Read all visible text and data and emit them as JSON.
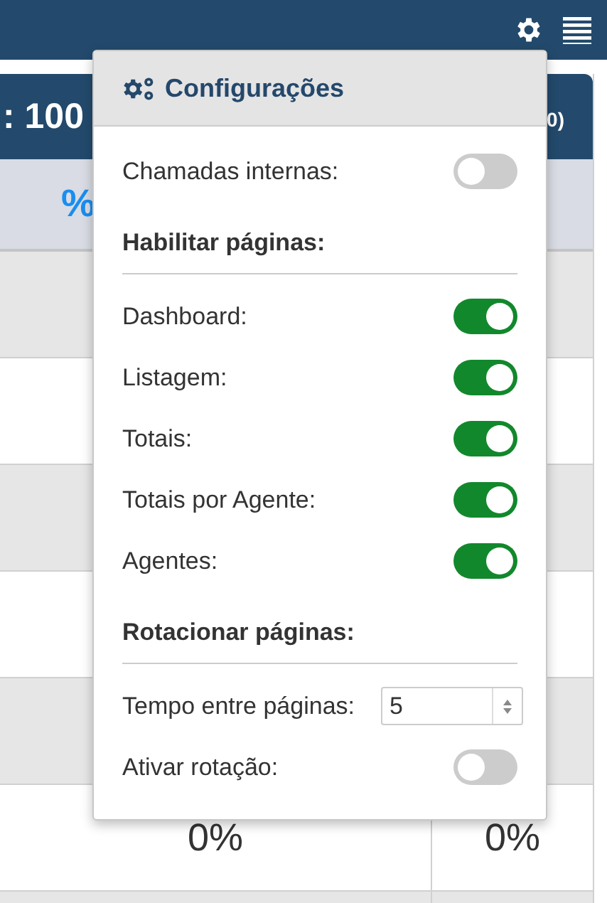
{
  "card": {
    "title": ": 100",
    "count": "0)",
    "column_header": "%",
    "bottom_row": [
      "0%",
      "0%"
    ]
  },
  "settings": {
    "title": "Configurações",
    "items": [
      {
        "kind": "toggle",
        "label": "Chamadas internas:",
        "on": false
      },
      {
        "kind": "heading",
        "label": "Habilitar páginas:"
      },
      {
        "kind": "toggle",
        "label": "Dashboard:",
        "on": true
      },
      {
        "kind": "toggle",
        "label": "Listagem:",
        "on": true
      },
      {
        "kind": "toggle",
        "label": "Totais:",
        "on": true
      },
      {
        "kind": "toggle",
        "label": "Totais por Agente:",
        "on": true
      },
      {
        "kind": "toggle",
        "label": "Agentes:",
        "on": true
      },
      {
        "kind": "heading",
        "label": "Rotacionar páginas:"
      },
      {
        "kind": "number",
        "label": "Tempo entre páginas:",
        "value": "5"
      },
      {
        "kind": "toggle",
        "label": "Ativar rotação:",
        "on": false
      }
    ]
  }
}
